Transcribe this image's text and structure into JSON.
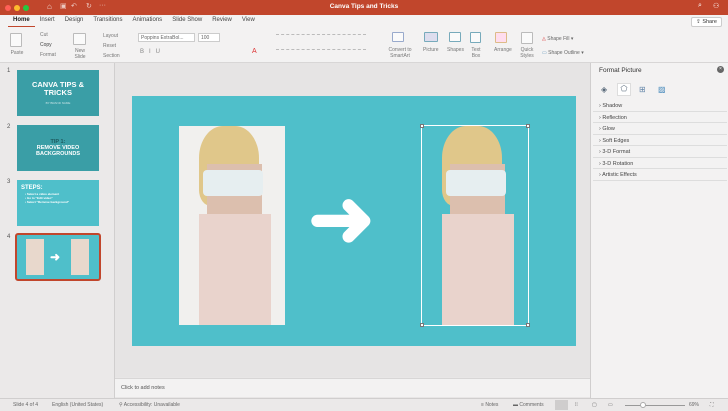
{
  "window": {
    "title": "Canva Tips and Tricks",
    "share_label": "Share"
  },
  "tabs": [
    "Home",
    "Insert",
    "Design",
    "Transitions",
    "Animations",
    "Slide Show",
    "Review",
    "View"
  ],
  "ribbon": {
    "paste": "Paste",
    "cut": "Cut",
    "copy": "Copy",
    "format": "Format",
    "new_slide": "New Slide",
    "layout": "Layout",
    "reset": "Reset",
    "section": "Section",
    "font": "Poppins ExtraBol...",
    "font_size": "100",
    "convert": "Convert to SmartArt",
    "picture": "Picture",
    "shapes": "Shapes",
    "text_box": "Text Box",
    "arrange": "Arrange",
    "quick_styles": "Quick Styles",
    "shape_fill": "Shape Fill",
    "shape_outline": "Shape Outline"
  },
  "thumbnails": [
    {
      "num": "1",
      "title": "CANVA TIPS & TRICKS",
      "sub": "BY BRAND NAME"
    },
    {
      "num": "2",
      "line1": "TIP 1:",
      "title": "REMOVE VIDEO BACKGROUNDS"
    },
    {
      "num": "3",
      "title": "STEPS:",
      "bullets": [
        "• Select a video element",
        "• Go to \"Edit video\"",
        "• Select \"Remove background\""
      ]
    },
    {
      "num": "4"
    }
  ],
  "notes_placeholder": "Click to add notes",
  "format_pane": {
    "title": "Format Picture",
    "sections": [
      "Shadow",
      "Reflection",
      "Glow",
      "Soft Edges",
      "3-D Format",
      "3-D Rotation",
      "Artistic Effects"
    ]
  },
  "status": {
    "slide": "Slide 4 of 4",
    "language": "English (United States)",
    "accessibility": "Accessibility: Unavailable",
    "notes": "Notes",
    "comments": "Comments",
    "zoom": "69%"
  },
  "colors": {
    "accent": "#c1462c",
    "slide_bg": "#4fbfca",
    "thumb_bg": "#3a9ea6"
  }
}
